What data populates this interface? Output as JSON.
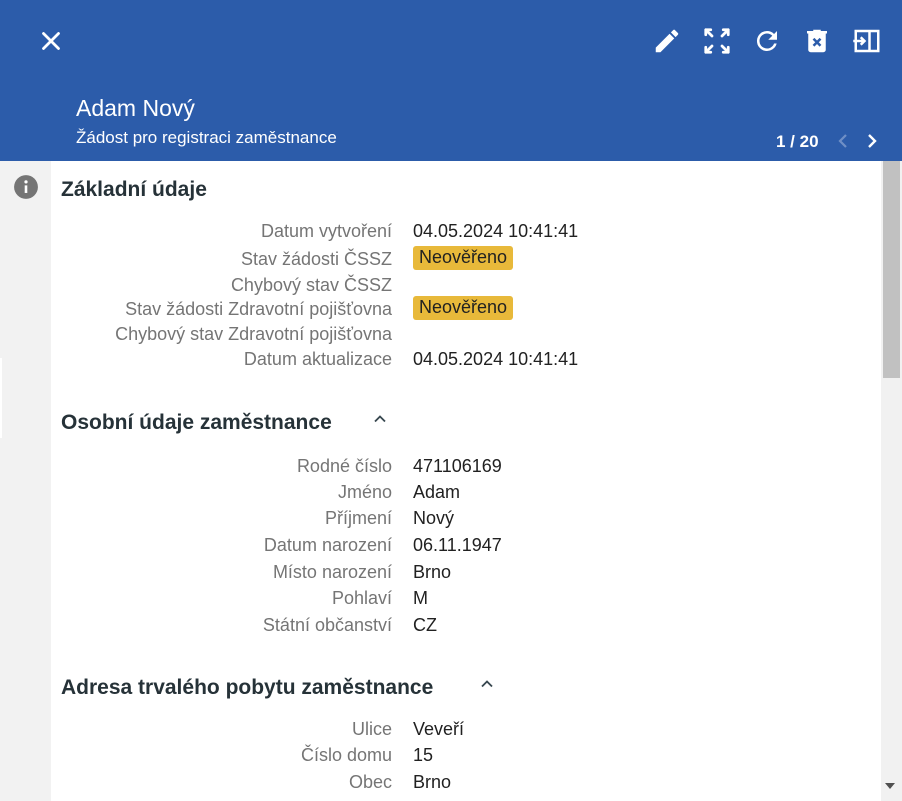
{
  "header": {
    "title": "Adam Nový",
    "subtitle": "Žádost pro registraci zaměstnance",
    "pager": "1 / 20",
    "background": "#2c5caa"
  },
  "toolbar": {
    "icons": [
      "close-icon",
      "edit-icon",
      "fullscreen-icon",
      "refresh-icon",
      "delete-icon",
      "exit-panel-icon",
      "chevron-left-icon",
      "chevron-right-icon",
      "info-icon",
      "chevron-up-icon"
    ]
  },
  "sections": {
    "zakladni": {
      "title": "Základní údaje",
      "rows": [
        {
          "label": "Datum vytvoření",
          "value": "04.05.2024 10:41:41"
        },
        {
          "label": "Stav žádosti ČSSZ",
          "value": "Neověřeno"
        },
        {
          "label": "Chybový stav ČSSZ",
          "value": ""
        },
        {
          "label": "Stav žádosti Zdravotní pojišťovna",
          "value": "Neověřeno"
        },
        {
          "label": "Chybový stav Zdravotní pojišťovna",
          "value": ""
        },
        {
          "label": "Datum aktualizace",
          "value": "04.05.2024 10:41:41"
        }
      ]
    },
    "osobni": {
      "title": "Osobní údaje zaměstnance",
      "rows": [
        {
          "label": "Rodné číslo",
          "value": "471106169"
        },
        {
          "label": "Jméno",
          "value": "Adam"
        },
        {
          "label": "Příjmení",
          "value": "Nový"
        },
        {
          "label": "Datum narození",
          "value": "06.11.1947"
        },
        {
          "label": "Místo narození",
          "value": "Brno"
        },
        {
          "label": "Pohlaví",
          "value": "M"
        },
        {
          "label": "Státní občanství",
          "value": "CZ"
        }
      ]
    },
    "adresa": {
      "title": "Adresa trvalého pobytu zaměstnance",
      "rows": [
        {
          "label": "Ulice",
          "value": "Veveří"
        },
        {
          "label": "Číslo domu",
          "value": "15"
        },
        {
          "label": "Obec",
          "value": "Brno"
        }
      ]
    }
  },
  "colors": {
    "badge": "#e8b93a",
    "label": "#757575",
    "value": "#212121"
  }
}
